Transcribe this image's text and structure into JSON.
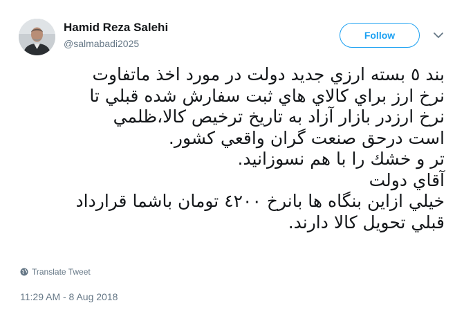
{
  "tweet": {
    "author": {
      "name": "Hamid Reza Salehi",
      "handle": "@salmabadi2025"
    },
    "follow_label": "Follow",
    "text_lines": [
      "بند ٥ بسته ارزي جديد دولت در مورد اخذ ماتفاوت",
      "نرخ ارز براي كالاي هاي ثبت سفارش شده قبلي تا",
      "نرخ ارزدر بازار آزاد به تاريخ ترخيص كالا،ظلمي",
      "است درحق صنعت گران واقعي كشور.",
      "تر و خشك را با هم نسوزانيد.",
      "آقاي دولت",
      "خيلي ازاين بنگاه ها بانرخ ٤٢٠٠ تومان باشما قرارداد",
      "قبلي تحويل كالا دارند."
    ],
    "translate_label": "Translate Tweet",
    "timestamp": "11:29 AM - 8 Aug 2018"
  },
  "colors": {
    "accent": "#1da1f2",
    "secondary_text": "#657786",
    "primary_text": "#14171a"
  },
  "icons": {
    "menu": "chevron-down-icon",
    "translate": "globe-icon"
  }
}
